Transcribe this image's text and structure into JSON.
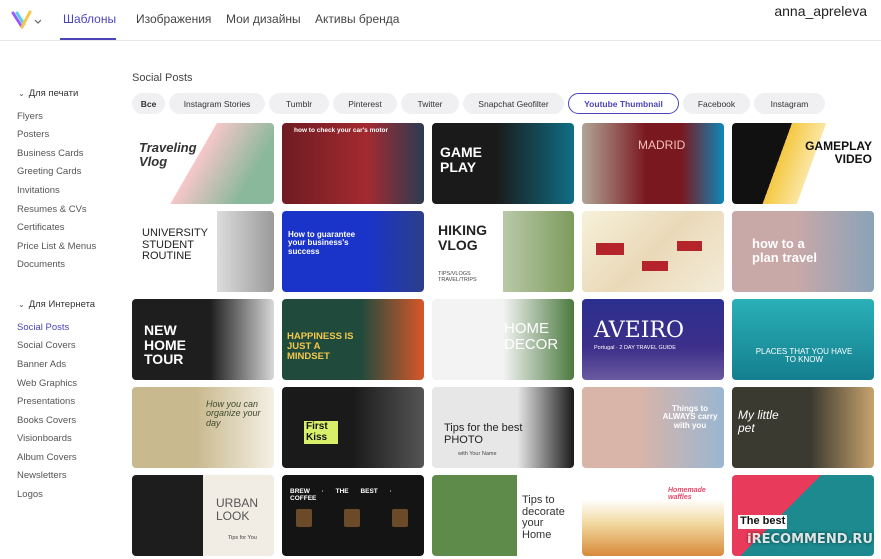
{
  "nav": {
    "tabs": [
      "Шаблоны",
      "Изображения",
      "Мои дизайны",
      "Активы бренда"
    ],
    "active_tab": "Шаблоны",
    "username": "anna_apreleva"
  },
  "sidebar": {
    "print_group": {
      "label": "Для печати",
      "items": [
        "Flyers",
        "Posters",
        "Business Cards",
        "Greeting Cards",
        "Invitations",
        "Resumes & CVs",
        "Certificates",
        "Price List & Menus",
        "Documents"
      ]
    },
    "web_group": {
      "label": "Для Интернета",
      "items": [
        "Social Posts",
        "Social Covers",
        "Banner Ads",
        "Web Graphics",
        "Presentations",
        "Books Covers",
        "Visionboards",
        "Album Covers",
        "Newsletters",
        "Logos"
      ]
    },
    "active_item": "Social Posts"
  },
  "main": {
    "title": "Social Posts",
    "chips": [
      "Все",
      "Instagram Stories",
      "Tumblr",
      "Pinterest",
      "Twitter",
      "Snapchat Geofilter",
      "Youtube Thumbnail",
      "Facebook",
      "Instagram"
    ],
    "selected_chip": "Youtube Thumbnail"
  },
  "templates": [
    {
      "title": "Traveling Vlog",
      "sub": ""
    },
    {
      "title": "how to check your car's motor",
      "sub": ""
    },
    {
      "title": "GAME PLAY",
      "sub": ""
    },
    {
      "title": "MADRID",
      "sub": ""
    },
    {
      "title": "GAMEPLAY VIDEO",
      "sub": ""
    },
    {
      "title": "UNIVERSITY STUDENT ROUTINE",
      "sub": ""
    },
    {
      "title": "How to guarantee your business's success",
      "sub": ""
    },
    {
      "title": "HIKING VLOG",
      "sub": "TIPS/VLOGS TRAVEL/TRIPS"
    },
    {
      "title": "",
      "sub": ""
    },
    {
      "title": "how to a plan travel",
      "sub": ""
    },
    {
      "title": "NEW HOME TOUR",
      "sub": ""
    },
    {
      "title": "HAPPINESS IS JUST A MINDSET",
      "sub": ""
    },
    {
      "title": "HOME DECOR",
      "sub": ""
    },
    {
      "title": "AVEIRO",
      "sub": "Portugal · 2 DAY TRAVEL GUIDE"
    },
    {
      "title": "PLACES THAT YOU HAVE TO KNOW",
      "sub": ""
    },
    {
      "title": "How you can organize your day",
      "sub": ""
    },
    {
      "title": "First Kiss",
      "sub": ""
    },
    {
      "title": "Tips for the best PHOTO",
      "sub": "with Your Name"
    },
    {
      "title": "Things to ALWAYS carry with you",
      "sub": ""
    },
    {
      "title": "My little pet",
      "sub": ""
    },
    {
      "title": "URBAN LOOK",
      "sub": "Tips for You"
    },
    {
      "title": "BREW · THE BEST · COFFEE",
      "sub": ""
    },
    {
      "title": "Tips to decorate your Home",
      "sub": ""
    },
    {
      "title": "Homemade waffles",
      "sub": ""
    },
    {
      "title": "The best",
      "sub": ""
    }
  ],
  "watermark": "iRECOMMEND.RU"
}
